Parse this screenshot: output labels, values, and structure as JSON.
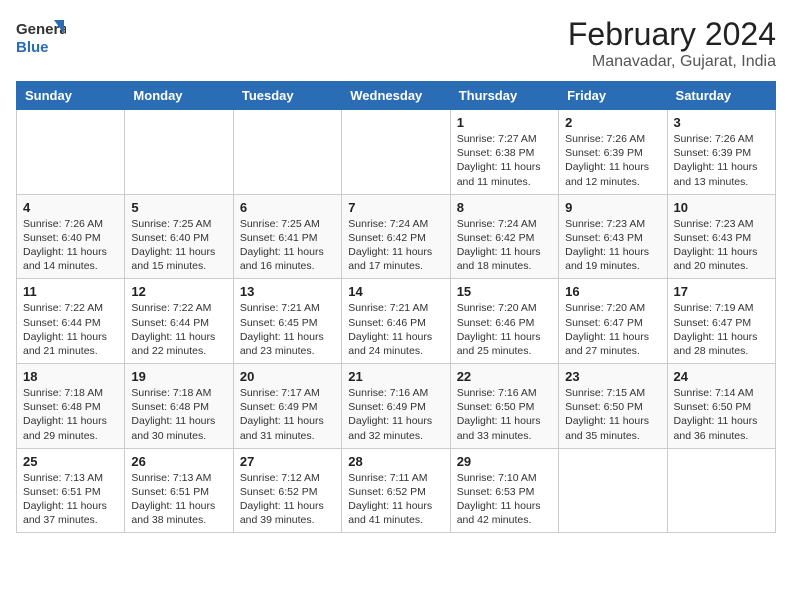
{
  "header": {
    "logo_general": "General",
    "logo_blue": "Blue",
    "month_title": "February 2024",
    "location": "Manavadar, Gujarat, India"
  },
  "days_of_week": [
    "Sunday",
    "Monday",
    "Tuesday",
    "Wednesday",
    "Thursday",
    "Friday",
    "Saturday"
  ],
  "weeks": [
    [
      {
        "day": "",
        "info": ""
      },
      {
        "day": "",
        "info": ""
      },
      {
        "day": "",
        "info": ""
      },
      {
        "day": "",
        "info": ""
      },
      {
        "day": "1",
        "info": "Sunrise: 7:27 AM\nSunset: 6:38 PM\nDaylight: 11 hours and 11 minutes."
      },
      {
        "day": "2",
        "info": "Sunrise: 7:26 AM\nSunset: 6:39 PM\nDaylight: 11 hours and 12 minutes."
      },
      {
        "day": "3",
        "info": "Sunrise: 7:26 AM\nSunset: 6:39 PM\nDaylight: 11 hours and 13 minutes."
      }
    ],
    [
      {
        "day": "4",
        "info": "Sunrise: 7:26 AM\nSunset: 6:40 PM\nDaylight: 11 hours and 14 minutes."
      },
      {
        "day": "5",
        "info": "Sunrise: 7:25 AM\nSunset: 6:40 PM\nDaylight: 11 hours and 15 minutes."
      },
      {
        "day": "6",
        "info": "Sunrise: 7:25 AM\nSunset: 6:41 PM\nDaylight: 11 hours and 16 minutes."
      },
      {
        "day": "7",
        "info": "Sunrise: 7:24 AM\nSunset: 6:42 PM\nDaylight: 11 hours and 17 minutes."
      },
      {
        "day": "8",
        "info": "Sunrise: 7:24 AM\nSunset: 6:42 PM\nDaylight: 11 hours and 18 minutes."
      },
      {
        "day": "9",
        "info": "Sunrise: 7:23 AM\nSunset: 6:43 PM\nDaylight: 11 hours and 19 minutes."
      },
      {
        "day": "10",
        "info": "Sunrise: 7:23 AM\nSunset: 6:43 PM\nDaylight: 11 hours and 20 minutes."
      }
    ],
    [
      {
        "day": "11",
        "info": "Sunrise: 7:22 AM\nSunset: 6:44 PM\nDaylight: 11 hours and 21 minutes."
      },
      {
        "day": "12",
        "info": "Sunrise: 7:22 AM\nSunset: 6:44 PM\nDaylight: 11 hours and 22 minutes."
      },
      {
        "day": "13",
        "info": "Sunrise: 7:21 AM\nSunset: 6:45 PM\nDaylight: 11 hours and 23 minutes."
      },
      {
        "day": "14",
        "info": "Sunrise: 7:21 AM\nSunset: 6:46 PM\nDaylight: 11 hours and 24 minutes."
      },
      {
        "day": "15",
        "info": "Sunrise: 7:20 AM\nSunset: 6:46 PM\nDaylight: 11 hours and 25 minutes."
      },
      {
        "day": "16",
        "info": "Sunrise: 7:20 AM\nSunset: 6:47 PM\nDaylight: 11 hours and 27 minutes."
      },
      {
        "day": "17",
        "info": "Sunrise: 7:19 AM\nSunset: 6:47 PM\nDaylight: 11 hours and 28 minutes."
      }
    ],
    [
      {
        "day": "18",
        "info": "Sunrise: 7:18 AM\nSunset: 6:48 PM\nDaylight: 11 hours and 29 minutes."
      },
      {
        "day": "19",
        "info": "Sunrise: 7:18 AM\nSunset: 6:48 PM\nDaylight: 11 hours and 30 minutes."
      },
      {
        "day": "20",
        "info": "Sunrise: 7:17 AM\nSunset: 6:49 PM\nDaylight: 11 hours and 31 minutes."
      },
      {
        "day": "21",
        "info": "Sunrise: 7:16 AM\nSunset: 6:49 PM\nDaylight: 11 hours and 32 minutes."
      },
      {
        "day": "22",
        "info": "Sunrise: 7:16 AM\nSunset: 6:50 PM\nDaylight: 11 hours and 33 minutes."
      },
      {
        "day": "23",
        "info": "Sunrise: 7:15 AM\nSunset: 6:50 PM\nDaylight: 11 hours and 35 minutes."
      },
      {
        "day": "24",
        "info": "Sunrise: 7:14 AM\nSunset: 6:50 PM\nDaylight: 11 hours and 36 minutes."
      }
    ],
    [
      {
        "day": "25",
        "info": "Sunrise: 7:13 AM\nSunset: 6:51 PM\nDaylight: 11 hours and 37 minutes."
      },
      {
        "day": "26",
        "info": "Sunrise: 7:13 AM\nSunset: 6:51 PM\nDaylight: 11 hours and 38 minutes."
      },
      {
        "day": "27",
        "info": "Sunrise: 7:12 AM\nSunset: 6:52 PM\nDaylight: 11 hours and 39 minutes."
      },
      {
        "day": "28",
        "info": "Sunrise: 7:11 AM\nSunset: 6:52 PM\nDaylight: 11 hours and 41 minutes."
      },
      {
        "day": "29",
        "info": "Sunrise: 7:10 AM\nSunset: 6:53 PM\nDaylight: 11 hours and 42 minutes."
      },
      {
        "day": "",
        "info": ""
      },
      {
        "day": "",
        "info": ""
      }
    ]
  ]
}
